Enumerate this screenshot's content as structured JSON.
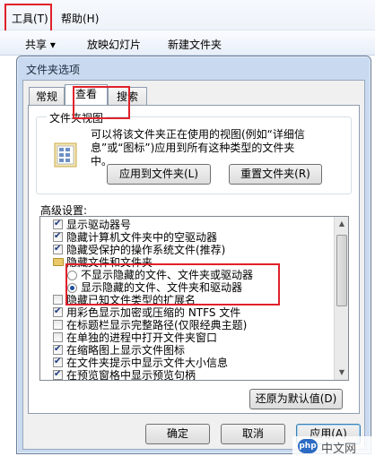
{
  "menubar": {
    "tools": "工具(T)",
    "help": "帮助(H)"
  },
  "commandbar": {
    "share": "共享 ▾",
    "slideshow": "放映幻灯片",
    "new_folder": "新建文件夹"
  },
  "dialog": {
    "title": "文件夹选项",
    "tabs": [
      "常规",
      "查看",
      "搜索"
    ],
    "folder_views": {
      "title": "文件夹视图",
      "description": "可以将该文件夹正在使用的视图(例如“详细信息”或“图标”)应用到所有这种类型的文件夹中。",
      "apply_button": "应用到文件夹(L)",
      "reset_button": "重置文件夹(R)"
    },
    "advanced": {
      "label": "高级设置:",
      "items": [
        {
          "label": "显示驱动器号",
          "type": "checkbox",
          "checked": true
        },
        {
          "label": "隐藏计算机文件夹中的空驱动器",
          "type": "checkbox",
          "checked": true
        },
        {
          "label": "隐藏受保护的操作系统文件(推荐)",
          "type": "checkbox",
          "checked": true
        },
        {
          "label": "隐藏文件和文件夹",
          "type": "folder"
        },
        {
          "label": "不显示隐藏的文件、文件夹或驱动器",
          "type": "radio",
          "checked": false
        },
        {
          "label": "显示隐藏的文件、文件夹和驱动器",
          "type": "radio",
          "checked": true
        },
        {
          "label": "隐藏已知文件类型的扩展名",
          "type": "checkbox",
          "checked": false
        },
        {
          "label": "用彩色显示加密或压缩的 NTFS 文件",
          "type": "checkbox",
          "checked": true
        },
        {
          "label": "在标题栏显示完整路径(仅限经典主题)",
          "type": "checkbox",
          "checked": false
        },
        {
          "label": "在单独的进程中打开文件夹窗口",
          "type": "checkbox",
          "checked": false
        },
        {
          "label": "在缩略图上显示文件图标",
          "type": "checkbox",
          "checked": true
        },
        {
          "label": "在文件夹提示中显示文件大小信息",
          "type": "checkbox",
          "checked": true
        },
        {
          "label": "在预览窗格中显示预览句柄",
          "type": "checkbox",
          "checked": true
        }
      ]
    },
    "restore_button": "还原为默认值(D)",
    "ok_button": "确定",
    "cancel_button": "取消",
    "apply_button": "应用(A)"
  },
  "watermark": {
    "badge": "php",
    "text": "中文网"
  },
  "colors": {
    "highlight": "#e0212a",
    "dialog_frame": "#c9daf0"
  }
}
